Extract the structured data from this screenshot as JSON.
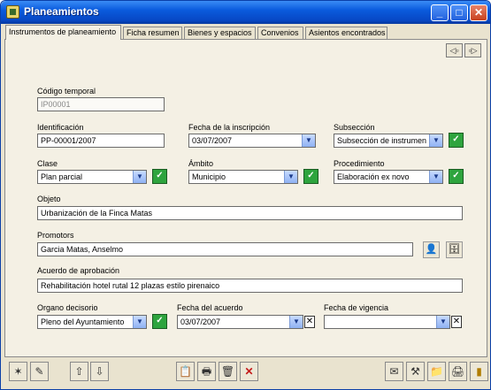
{
  "window": {
    "title": "Planeamientos",
    "minimize": "_",
    "maximize": "□",
    "close": "✕"
  },
  "tabs": [
    {
      "label": "Instrumentos de planeamiento"
    },
    {
      "label": "Ficha resumen"
    },
    {
      "label": "Bienes y espacios"
    },
    {
      "label": "Convenios"
    },
    {
      "label": "Asientos encontrados"
    }
  ],
  "nav": {
    "prev": "◁▫",
    "next": "▫▷"
  },
  "form": {
    "codigo_temporal": {
      "label": "Código temporal",
      "value": "IP00001"
    },
    "identificacion": {
      "label": "Identificación",
      "value": "PP-00001/2007"
    },
    "fecha_inscripcion": {
      "label": "Fecha de la inscripción",
      "value": "03/07/2007"
    },
    "subseccion": {
      "label": "Subsección",
      "value": "Subsección de instrumen"
    },
    "clase": {
      "label": "Clase",
      "value": "Plan parcial"
    },
    "ambito": {
      "label": "Ámbito",
      "value": "Municipio"
    },
    "procedimiento": {
      "label": "Procedimiento",
      "value": "Elaboración ex novo"
    },
    "objeto": {
      "label": "Objeto",
      "value": "Urbanización de la Finca Matas"
    },
    "promotors": {
      "label": "Promotors",
      "value": "Garcia Matas, Anselmo"
    },
    "acuerdo": {
      "label": "Acuerdo de aprobación",
      "value": "Rehabilitación hotel rutal 12 plazas estilo pirenaico"
    },
    "organo": {
      "label": "Organo decisorio",
      "value": "Pleno del Ayuntamiento"
    },
    "fecha_acuerdo": {
      "label": "Fecha del acuerdo",
      "value": "03/07/2007"
    },
    "fecha_vigencia": {
      "label": "Fecha de vigencia",
      "value": ""
    }
  },
  "icons": {
    "dropdown": "▼",
    "green_check": "✓",
    "clear": "✕",
    "person": "👤",
    "archive": "🗄",
    "new": "✶",
    "edit": "✎",
    "up": "⇧",
    "down": "⇩",
    "copy": "📋",
    "print_preview": "🖶",
    "trash": "🗑",
    "delete": "✕",
    "mail": "✉",
    "tools": "⚒",
    "folder": "📁",
    "printer": "🖨",
    "exit": "▮"
  },
  "colors": {
    "titlebar": "#0a5bdd",
    "panel": "#f4f0e4",
    "window": "#e9e3cf",
    "accent_green": "#2ea43e",
    "delete_red": "#c41a1a"
  }
}
